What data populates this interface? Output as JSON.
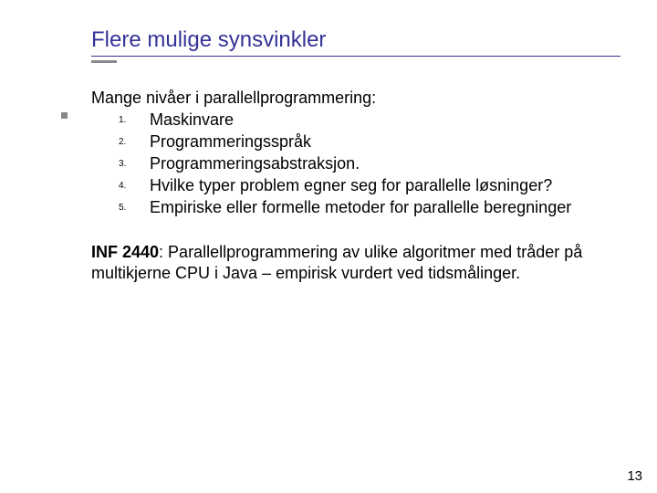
{
  "title": "Flere mulige synsvinkler",
  "intro": "Mange nivåer i parallellprogrammering:",
  "items": [
    {
      "num": "1.",
      "text": "Maskinvare"
    },
    {
      "num": "2.",
      "text": "Programmeringsspråk"
    },
    {
      "num": "3.",
      "text": "Programmeringsabstraksjon."
    },
    {
      "num": "4.",
      "text": "Hvilke typer problem egner seg for parallelle løsninger?"
    },
    {
      "num": "5.",
      "text": "Empiriske eller formelle metoder for parallelle beregninger"
    }
  ],
  "course_code": "INF 2440",
  "course_desc": ": Parallellprogrammering av ulike algoritmer med tråder på multikjerne CPU i Java – empirisk vurdert ved tidsmålinger.",
  "page_number": "13"
}
